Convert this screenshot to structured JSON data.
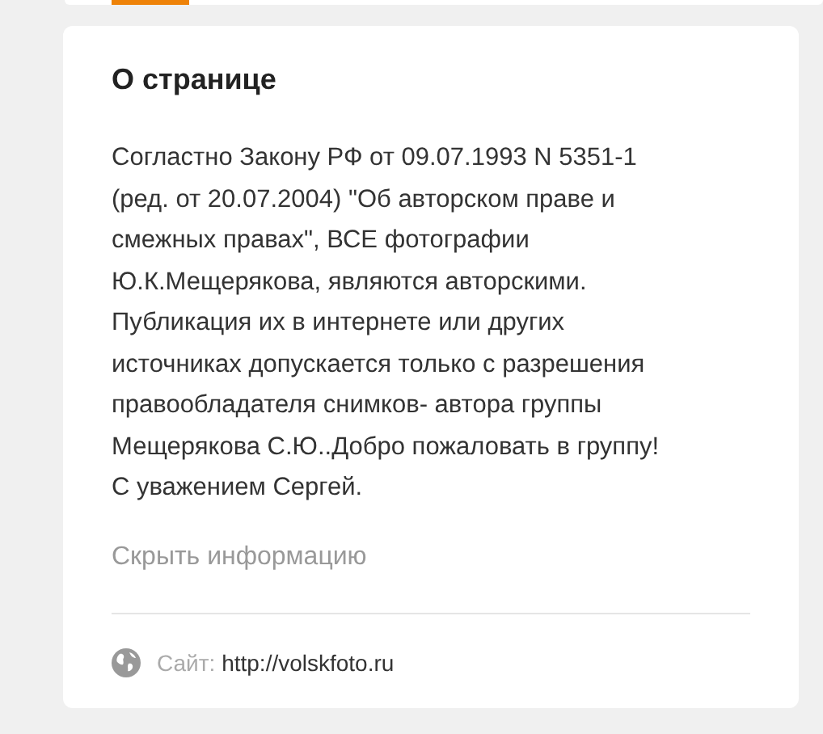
{
  "about": {
    "title": "О странице",
    "description_lines": [
      "Согластно Закону РФ от 09.07.1993 N 5351-1",
      "(ред. от 20.07.2004) \"Об авторском праве и",
      "смежных правах\", ВСЕ фотографии",
      "Ю.К.Мещерякова, являются авторскими.",
      "Публикация их в интернете или других",
      "источниках допускается только с разрешения",
      "правообладателя снимков- автора группы",
      "Мещерякова С.Ю..Добро пожаловать в группу!",
      "С уважением Сергей."
    ],
    "toggle_link": "Скрыть информацию",
    "site": {
      "label": "Сайт:",
      "url": "http://volskfoto.ru"
    }
  }
}
